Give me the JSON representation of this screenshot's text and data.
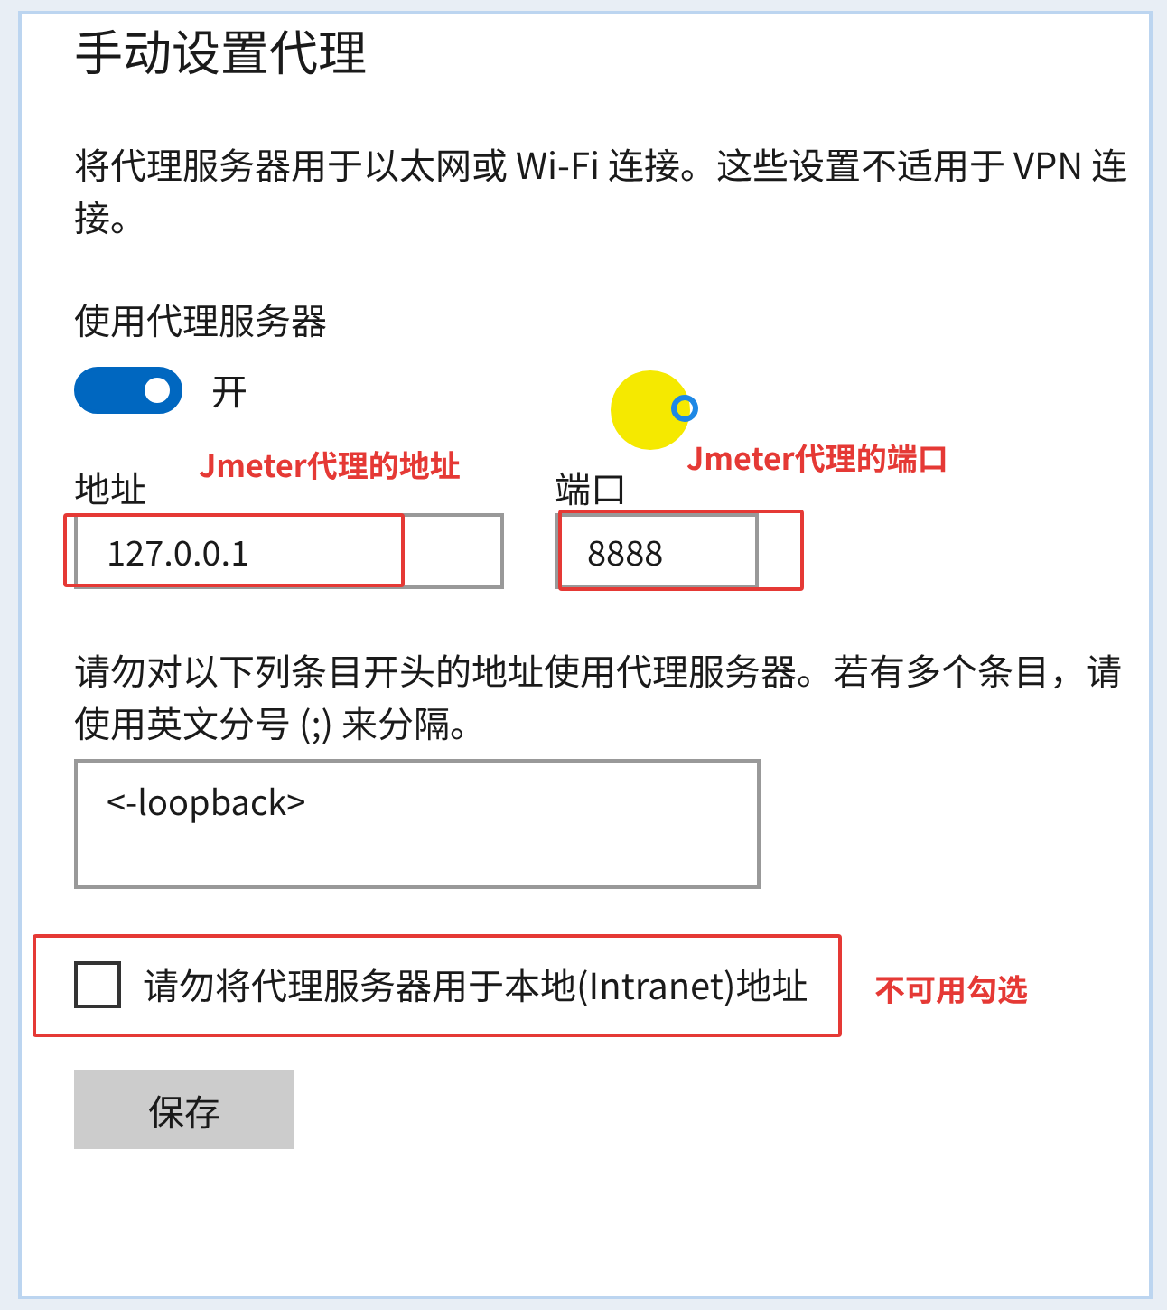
{
  "title": "手动设置代理",
  "description": "将代理服务器用于以太网或 Wi-Fi 连接。这些设置不适用于 VPN 连接。",
  "proxy_toggle": {
    "label": "使用代理服务器",
    "on": true,
    "state_text": "开"
  },
  "address": {
    "label": "地址",
    "value": "127.0.0.1"
  },
  "port": {
    "label": "端口",
    "value": "8888"
  },
  "exceptions": {
    "description": "请勿对以下列条目开头的地址使用代理服务器。若有多个条目，请使用英文分号 (;) 来分隔。",
    "value": "<-loopback>"
  },
  "bypass_local": {
    "label": "请勿将代理服务器用于本地(Intranet)地址",
    "checked": false
  },
  "save_button": "保存",
  "annotations": [
    "Jmeter代理的地址",
    "Jmeter代理的端口",
    "不可用勾选"
  ]
}
